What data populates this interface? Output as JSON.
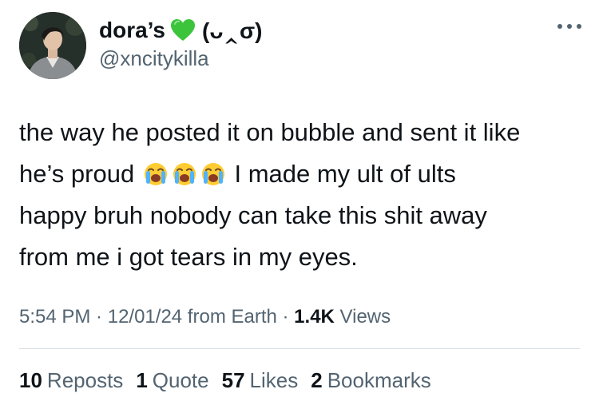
{
  "author": {
    "display_name": "dora’s",
    "emoticon": "(ᴗ‸σ)",
    "handle": "@xncitykilla",
    "heart_color": "#3cc43c"
  },
  "menu_icon": "more-horizontal-icon",
  "tweet": {
    "lines": [
      "the way he posted it on bubble and sent it like",
      "he’s proud",
      "I made my ult of ults",
      "happy bruh nobody can take this shit away",
      "from me i got tears in my eyes."
    ],
    "emoji": [
      "loudly-crying-face",
      "loudly-crying-face",
      "loudly-crying-face"
    ]
  },
  "meta": {
    "time": "5:54 PM",
    "sep1": " · ",
    "date": "12/01/24",
    "source": " from Earth",
    "sep2": " · ",
    "views_count": "1.4K",
    "views_label": "Views"
  },
  "stats": [
    {
      "count": "10",
      "label": "Reposts"
    },
    {
      "count": "1",
      "label": "Quote"
    },
    {
      "count": "57",
      "label": "Likes"
    },
    {
      "count": "2",
      "label": "Bookmarks"
    }
  ],
  "colors": {
    "text": "#0f1419",
    "secondary": "#536471",
    "divider": "#d8dde2"
  }
}
